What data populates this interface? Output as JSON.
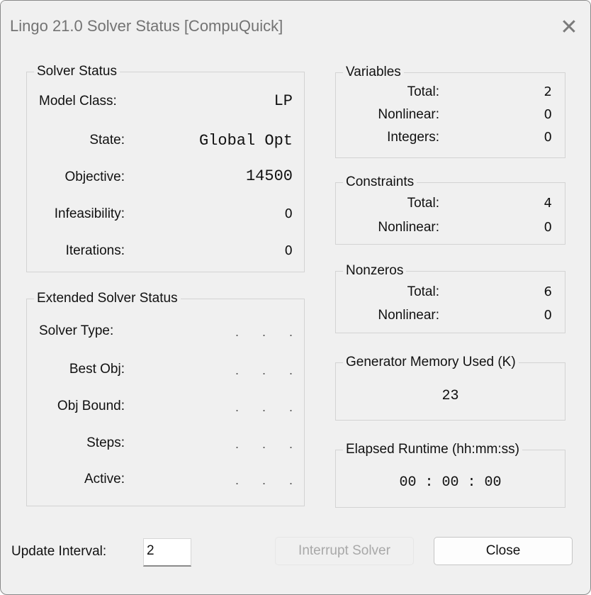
{
  "window": {
    "title": "Lingo 21.0 Solver Status [CompuQuick]",
    "close_glyph": "✕"
  },
  "solver_status": {
    "legend": "Solver Status",
    "model_class_label": "Model Class:",
    "model_class_value": "LP",
    "state_label": "State:",
    "state_value": "Global Opt",
    "objective_label": "Objective:",
    "objective_value": "14500",
    "infeasibility_label": "Infeasibility:",
    "infeasibility_value": "0",
    "iterations_label": "Iterations:",
    "iterations_value": "0"
  },
  "extended_status": {
    "legend": "Extended Solver Status",
    "solver_type_label": "Solver Type:",
    "best_obj_label": "Best Obj:",
    "obj_bound_label": "Obj Bound:",
    "steps_label": "Steps:",
    "active_label": "Active:",
    "placeholder": ". . ."
  },
  "variables": {
    "legend": "Variables",
    "total_label": "Total:",
    "total_value": "2",
    "nonlinear_label": "Nonlinear:",
    "nonlinear_value": "0",
    "integers_label": "Integers:",
    "integers_value": "0"
  },
  "constraints": {
    "legend": "Constraints",
    "total_label": "Total:",
    "total_value": "4",
    "nonlinear_label": "Nonlinear:",
    "nonlinear_value": "0"
  },
  "nonzeros": {
    "legend": "Nonzeros",
    "total_label": "Total:",
    "total_value": "6",
    "nonlinear_label": "Nonlinear:",
    "nonlinear_value": "0"
  },
  "generator_memory": {
    "legend": "Generator Memory Used (K)",
    "value": "23"
  },
  "elapsed_runtime": {
    "legend": "Elapsed Runtime (hh:mm:ss)",
    "value": "00 : 00 : 00"
  },
  "footer": {
    "update_interval_label": "Update Interval:",
    "update_interval_value": "2",
    "interrupt_button": "Interrupt Solver",
    "close_button": "Close"
  }
}
